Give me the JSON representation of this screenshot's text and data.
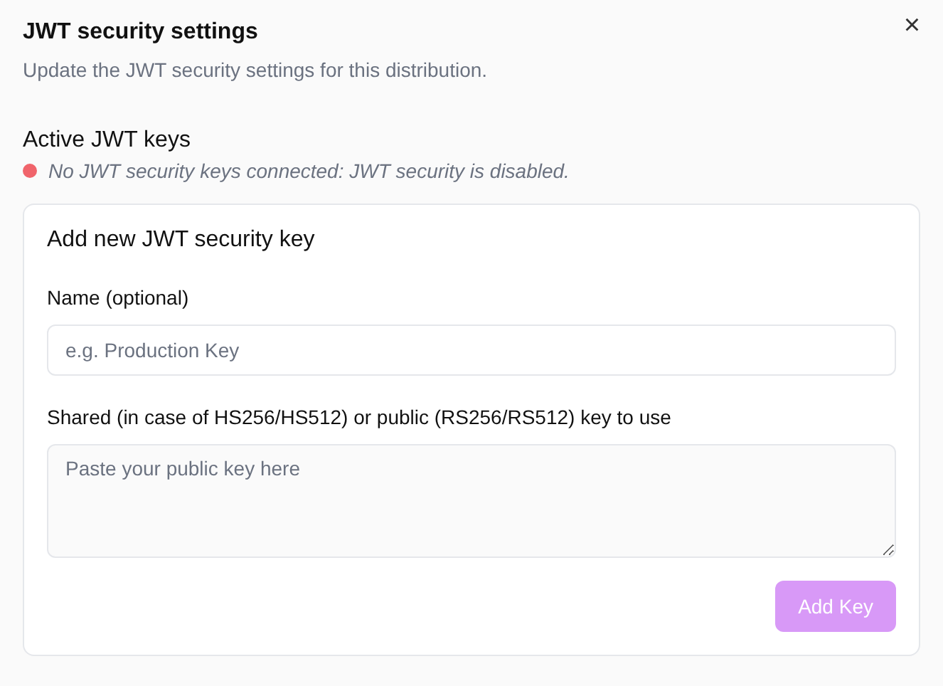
{
  "dialog": {
    "title": "JWT security settings",
    "subtitle": "Update the JWT security settings for this distribution.",
    "close_button": "×"
  },
  "active_keys": {
    "heading": "Active JWT keys",
    "status": {
      "text": "No JWT security keys connected: JWT security is disabled.",
      "color": "#f0646b"
    }
  },
  "add_key_card": {
    "heading": "Add new JWT security key",
    "fields": [
      {
        "kind": "input",
        "label": "Name (optional)",
        "placeholder": "e.g. Production Key"
      },
      {
        "kind": "textarea",
        "label": "Shared (in case of HS256/HS512) or public (RS256/RS512) key to use",
        "placeholder": "Paste your public key here"
      }
    ],
    "submit": {
      "label": "Add Key",
      "disabled": true
    }
  }
}
